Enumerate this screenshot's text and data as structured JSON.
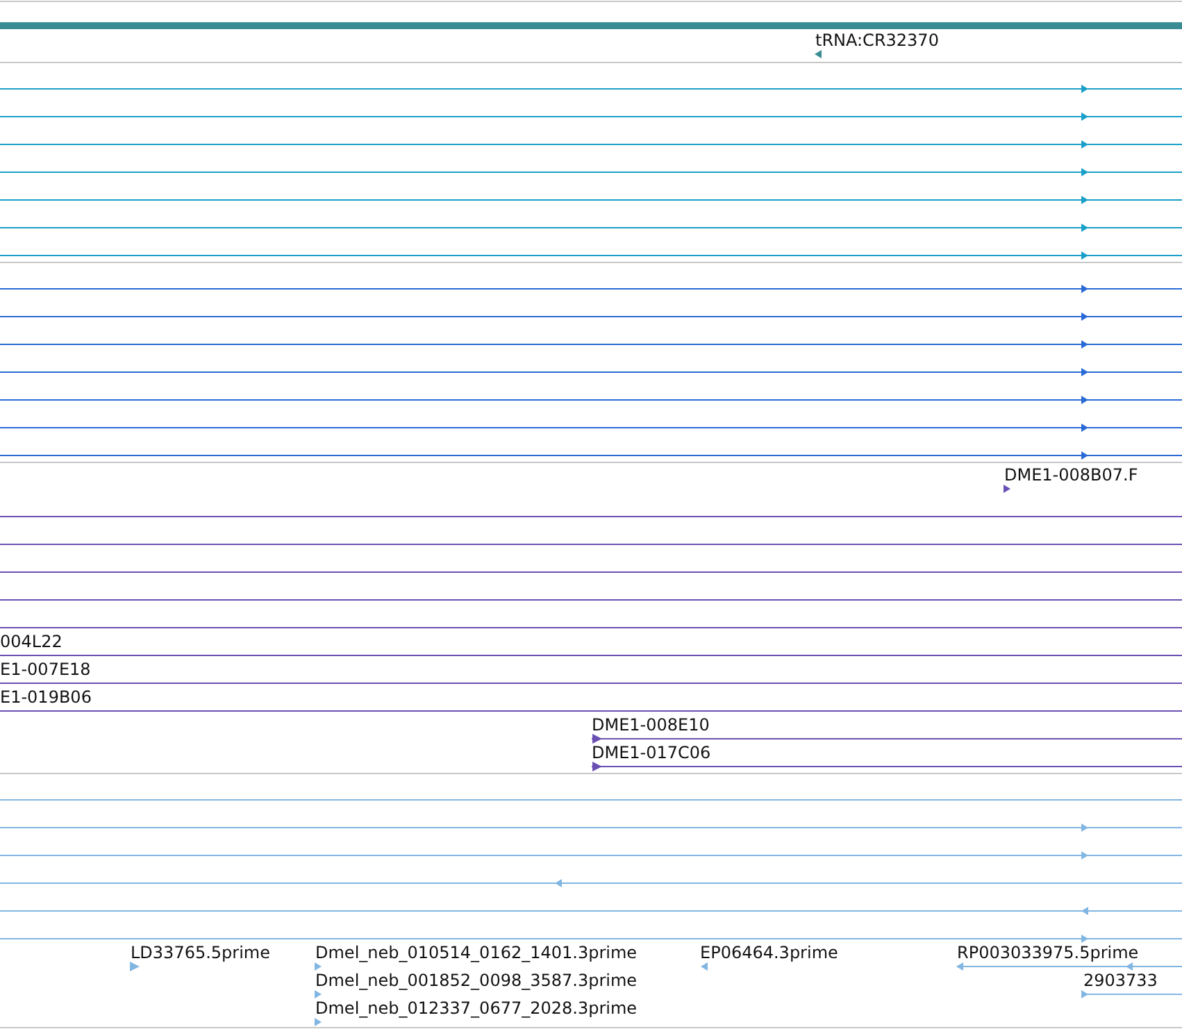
{
  "tracks": [
    {
      "color": "#3a8c93",
      "rows": [
        {
          "features": [
            {
              "kind": "bar"
            }
          ]
        },
        {
          "features": [
            {
              "kind": "point",
              "label": "tRNA:CR32370",
              "reverse": true
            }
          ]
        }
      ]
    },
    {
      "color": "#1a9fc8",
      "rows": [
        {
          "features": [
            {
              "kind": "line",
              "reverse": false
            }
          ]
        },
        {
          "features": [
            {
              "kind": "line",
              "reverse": false
            }
          ]
        },
        {
          "features": [
            {
              "kind": "line",
              "reverse": false
            }
          ]
        },
        {
          "features": [
            {
              "kind": "line",
              "reverse": false
            }
          ]
        },
        {
          "features": [
            {
              "kind": "line",
              "reverse": false
            }
          ]
        },
        {
          "features": [
            {
              "kind": "line",
              "reverse": false
            }
          ]
        },
        {
          "features": [
            {
              "kind": "line",
              "reverse": false
            }
          ]
        }
      ]
    },
    {
      "color": "#2a6ad6",
      "rows": [
        {
          "features": [
            {
              "kind": "line",
              "reverse": false
            }
          ]
        },
        {
          "features": [
            {
              "kind": "line",
              "reverse": false
            }
          ]
        },
        {
          "features": [
            {
              "kind": "line",
              "reverse": false
            }
          ]
        },
        {
          "features": [
            {
              "kind": "line",
              "reverse": false
            }
          ]
        },
        {
          "features": [
            {
              "kind": "line",
              "reverse": false
            }
          ]
        },
        {
          "features": [
            {
              "kind": "line",
              "reverse": false
            }
          ]
        },
        {
          "features": [
            {
              "kind": "line",
              "reverse": false
            }
          ]
        }
      ]
    },
    {
      "color": "#6b50b4",
      "rows": [
        {
          "features": [
            {
              "kind": "point",
              "label": "DME1-008B07.F",
              "reverse": false
            }
          ]
        },
        {
          "features": [
            {
              "kind": "line"
            }
          ]
        },
        {
          "features": [
            {
              "kind": "line"
            }
          ]
        },
        {
          "features": [
            {
              "kind": "line"
            }
          ]
        },
        {
          "features": [
            {
              "kind": "line"
            }
          ]
        },
        {
          "features": [
            {
              "kind": "line"
            }
          ]
        },
        {
          "features": [
            {
              "kind": "line",
              "label": "004L22"
            }
          ]
        },
        {
          "features": [
            {
              "kind": "line",
              "label": "E1-007E18"
            }
          ]
        },
        {
          "features": [
            {
              "kind": "line",
              "label": "E1-019B06"
            }
          ]
        },
        {
          "features": [
            {
              "kind": "line",
              "label": "DME1-008E10",
              "reverse": false
            }
          ]
        },
        {
          "features": [
            {
              "kind": "line",
              "label": "DME1-017C06",
              "reverse": false
            }
          ]
        }
      ]
    },
    {
      "color": "#82b6e2",
      "rows": [
        {
          "features": [
            {
              "kind": "line"
            }
          ]
        },
        {
          "features": [
            {
              "kind": "line",
              "reverse": false
            }
          ]
        },
        {
          "features": [
            {
              "kind": "line",
              "reverse": false
            }
          ]
        },
        {
          "features": [
            {
              "kind": "line",
              "reverse": true
            }
          ]
        },
        {
          "features": [
            {
              "kind": "line",
              "reverse": true
            }
          ]
        },
        {
          "features": [
            {
              "kind": "line",
              "reverse": false
            }
          ]
        },
        {
          "features": [
            {
              "kind": "point",
              "label": "LD33765.5prime",
              "reverse": false
            },
            {
              "kind": "point",
              "label": "Dmel_neb_010514_0162_1401.3prime",
              "reverse": false
            },
            {
              "kind": "point",
              "label": "EP06464.3prime",
              "reverse": true
            },
            {
              "kind": "line",
              "label": "RP003033975.5prime",
              "reverse": true
            }
          ]
        },
        {
          "features": [
            {
              "kind": "point",
              "label": "Dmel_neb_001852_0098_3587.3prime",
              "reverse": false
            },
            {
              "kind": "line",
              "label": "2903733",
              "reverse": false
            }
          ]
        },
        {
          "features": [
            {
              "kind": "point",
              "label": "Dmel_neb_012337_0677_2028.3prime",
              "reverse": false
            }
          ]
        }
      ]
    }
  ]
}
